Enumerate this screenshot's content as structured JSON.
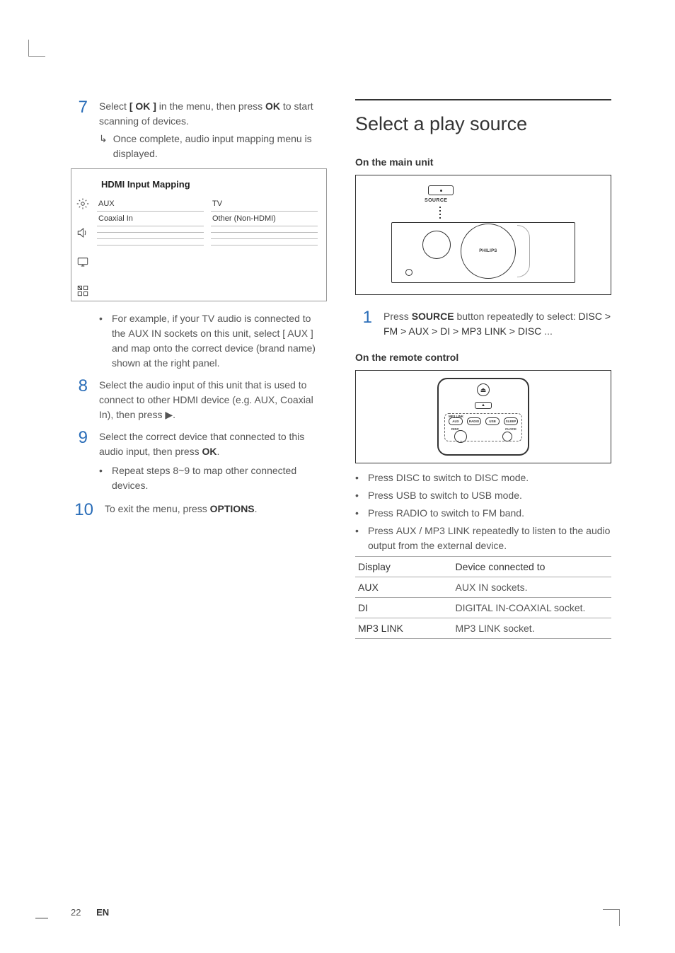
{
  "left": {
    "step7": {
      "num": "7",
      "text_pre": "Select ",
      "ok_brackets": "[ OK ]",
      "text_mid": " in the menu, then press ",
      "ok_bold": "OK",
      "text_post": " to start scanning of devices.",
      "sub": "Once complete, audio input mapping menu is displayed."
    },
    "hdmi": {
      "title": "HDMI Input Mapping",
      "rows": [
        [
          "AUX",
          "TV"
        ],
        [
          "Coaxial In",
          "Other (Non-HDMI)"
        ],
        [
          "",
          ""
        ],
        [
          "",
          ""
        ],
        [
          "",
          ""
        ]
      ]
    },
    "step7_bullet": {
      "pre": "For example, if your TV audio is connected to the ",
      "b1": "AUX IN",
      "mid1": " sockets on this unit, select ",
      "b2": "[ AUX ]",
      "post": " and map onto the correct device (brand name) shown at the right panel."
    },
    "step8": {
      "num": "8",
      "text": "Select the audio input of this unit that is used to connect to other HDMI device (e.g. AUX, Coaxial In), then press ",
      "glyph": "▶",
      "end": "."
    },
    "step9": {
      "num": "9",
      "text_pre": "Select the correct device that connected to this audio input, then press ",
      "ok": "OK",
      "end": ".",
      "bullet": "Repeat steps 8~9 to map other connected devices."
    },
    "step10": {
      "num": "10",
      "text_pre": "To exit the menu, press ",
      "b": "OPTIONS",
      "end": "."
    }
  },
  "right": {
    "heading": "Select a play source",
    "on_main": "On the main unit",
    "main_source_label": "SOURCE",
    "main_brand": "PHILIPS",
    "step1": {
      "num": "1",
      "pre": "Press ",
      "b": "SOURCE",
      "mid": " button repeatedly to select: ",
      "seq": "DISC > FM > AUX > DI > MP3 LINK >  DISC",
      "end": " ..."
    },
    "on_remote": "On the remote control",
    "remote_labels": {
      "mp3link": "MP3 LINK",
      "aux": "AUX",
      "radio": "RADIO",
      "usb": "USB",
      "sleep": "SLEEP",
      "disc": "DISC",
      "clock": "CLOCK"
    },
    "bullets": [
      {
        "pre": "Press ",
        "b": "DISC",
        "post": " to switch to DISC mode."
      },
      {
        "pre": "Press ",
        "b": "USB",
        "post": " to switch to USB mode."
      },
      {
        "pre": "Press ",
        "b": "RADIO",
        "post": " to switch to FM band."
      },
      {
        "pre": "Press ",
        "b": "AUX / MP3 LINK",
        "post": " repeatedly to listen to the audio output from the external device."
      }
    ],
    "table": {
      "h1": "Display",
      "h2": "Device connected to",
      "rows": [
        {
          "d": "AUX",
          "c": "AUX IN sockets."
        },
        {
          "d": "DI",
          "c": "DIGITAL IN-COAXIAL socket."
        },
        {
          "d": "MP3 LINK",
          "c": "MP3 LINK socket."
        }
      ]
    }
  },
  "footer": {
    "page": "22",
    "lang": "EN"
  }
}
